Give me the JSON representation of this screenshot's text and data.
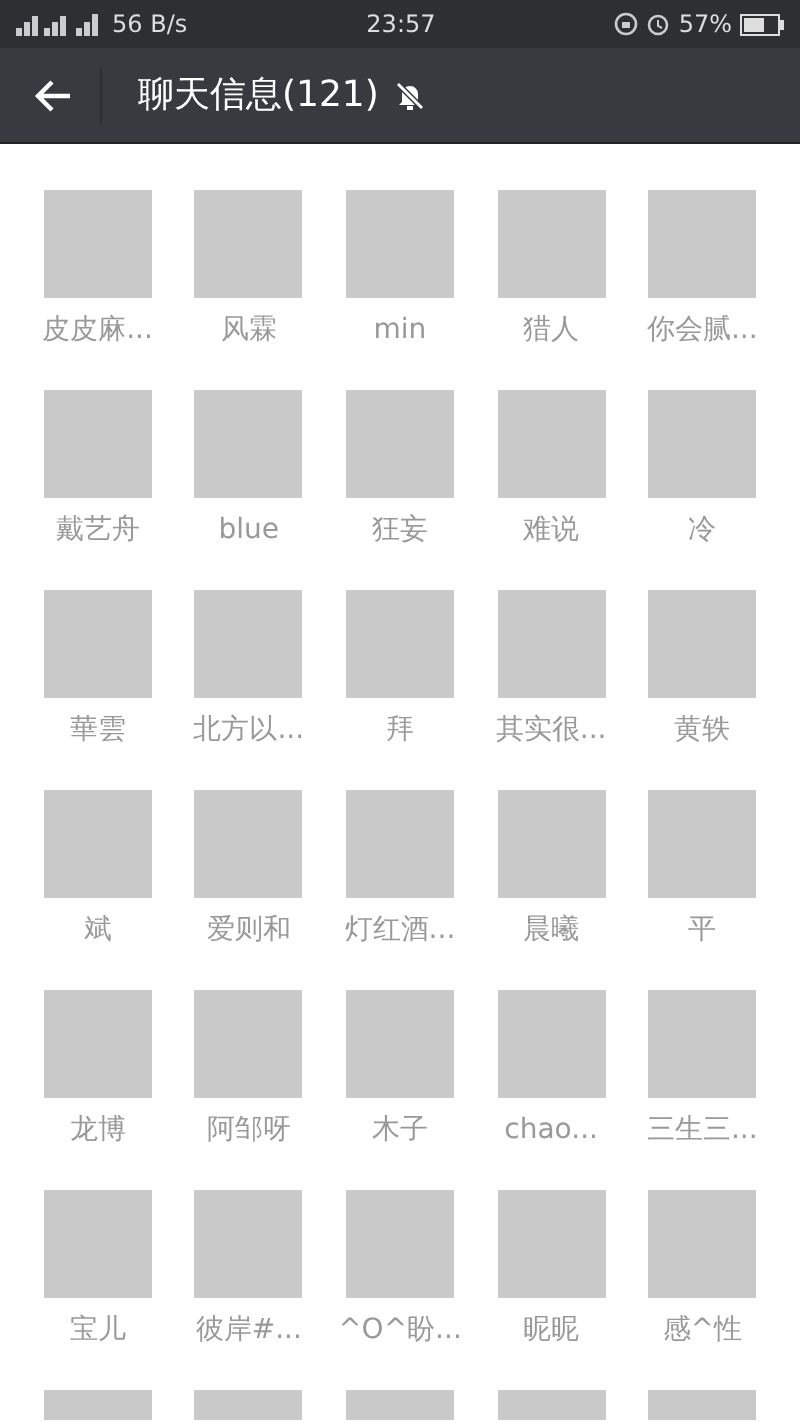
{
  "status_bar": {
    "network_speed": "56 B/s",
    "time": "23:57",
    "battery": "57%"
  },
  "header": {
    "title": "聊天信息(121)",
    "muted": true
  },
  "members": [
    {
      "name": "皮皮麻...",
      "cut": false
    },
    {
      "name": "风霖",
      "cut": false
    },
    {
      "name": "min",
      "cut": false
    },
    {
      "name": "猎人",
      "cut": false
    },
    {
      "name": "你会腻...",
      "cut": false
    },
    {
      "name": "戴艺舟",
      "cut": false
    },
    {
      "name": "blue",
      "cut": false
    },
    {
      "name": "狂妄",
      "cut": false
    },
    {
      "name": "难说",
      "cut": false
    },
    {
      "name": "冷",
      "cut": false
    },
    {
      "name": "華雲",
      "cut": false
    },
    {
      "name": "北方以...",
      "cut": false
    },
    {
      "name": "拜",
      "cut": false
    },
    {
      "name": "其实很...",
      "cut": false
    },
    {
      "name": "黄轶",
      "cut": false
    },
    {
      "name": "斌",
      "cut": false
    },
    {
      "name": "爱则和",
      "cut": false
    },
    {
      "name": "灯红酒...",
      "cut": false
    },
    {
      "name": "晨曦",
      "cut": false
    },
    {
      "name": "平",
      "cut": false
    },
    {
      "name": "龙博",
      "cut": false
    },
    {
      "name": "阿邹呀",
      "cut": false
    },
    {
      "name": "木子",
      "cut": false
    },
    {
      "name": "chao...",
      "cut": false
    },
    {
      "name": "三生三...",
      "cut": false
    },
    {
      "name": "宝儿",
      "cut": false
    },
    {
      "name": "彼岸#...",
      "cut": false
    },
    {
      "name": "^O^盼...",
      "cut": false
    },
    {
      "name": "昵昵",
      "cut": false
    },
    {
      "name": "感^性",
      "cut": false
    },
    {
      "cut": true
    },
    {
      "cut": true
    },
    {
      "cut": true
    },
    {
      "cut": true
    },
    {
      "cut": true
    }
  ]
}
